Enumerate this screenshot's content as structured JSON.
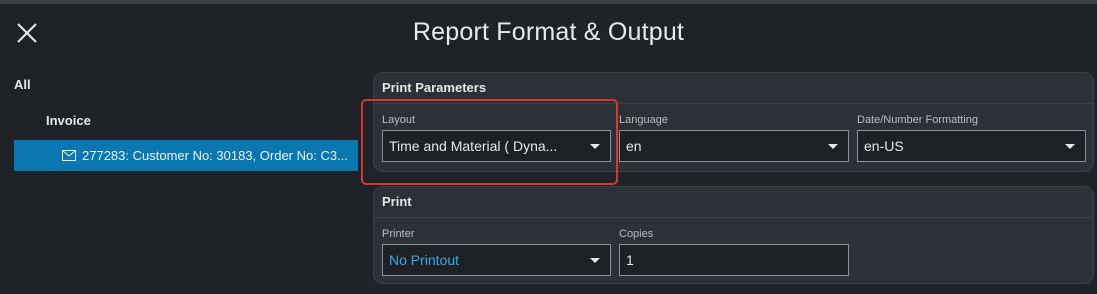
{
  "header": {
    "title": "Report Format & Output"
  },
  "sidebar": {
    "all_label": "All",
    "group_label": "Invoice",
    "items": [
      {
        "label": "277283: Customer No: 30183, Order No: C3..."
      }
    ]
  },
  "print_parameters": {
    "title": "Print Parameters",
    "layout": {
      "label": "Layout",
      "value": "Time and Material ( Dyna..."
    },
    "language": {
      "label": "Language",
      "value": "en"
    },
    "formatting": {
      "label": "Date/Number Formatting",
      "value": "en-US"
    }
  },
  "print": {
    "title": "Print",
    "printer": {
      "label": "Printer",
      "value": "No Printout"
    },
    "copies": {
      "label": "Copies",
      "value": "1"
    }
  },
  "colors": {
    "background": "#1f2327",
    "panel": "#2b3136",
    "selected": "#0b77b0",
    "link": "#37a9e6",
    "highlight": "#d9382c"
  },
  "icons": {
    "close": "close-icon",
    "mail": "mail-icon",
    "dropdown": "chevron-down-icon"
  }
}
